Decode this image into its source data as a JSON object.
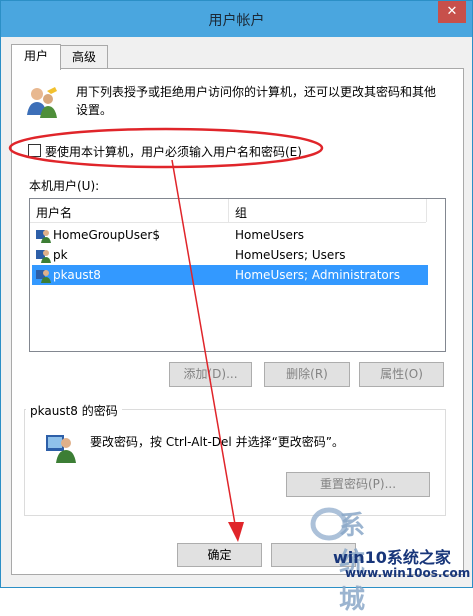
{
  "window": {
    "title": "用户帐户",
    "close_glyph": "✕"
  },
  "tabs": [
    {
      "label": "用户"
    },
    {
      "label": "高级"
    }
  ],
  "description": "用下列表授予或拒绝用户访问你的计算机，还可以更改其密码和其他设置。",
  "require_login_checkbox": {
    "label": "要使用本计算机，用户必须输入用户名和密码(E)",
    "checked": false
  },
  "users_list": {
    "label": "本机用户(U):",
    "columns": [
      "用户名",
      "组"
    ],
    "rows": [
      {
        "name": "HomeGroupUser$",
        "group": "HomeUsers",
        "selected": false
      },
      {
        "name": "pk",
        "group": "HomeUsers; Users",
        "selected": false
      },
      {
        "name": "pkaust8",
        "group": "HomeUsers; Administrators",
        "selected": true
      }
    ]
  },
  "list_buttons": {
    "add": "添加(D)...",
    "remove": "删除(R)",
    "properties": "属性(O)"
  },
  "password_group": {
    "title": "pkaust8 的密码",
    "text": "要改密码，按 Ctrl-Alt-Del 并选择“更改密码”。",
    "reset_button": "重置密码(P)..."
  },
  "dialog_buttons": {
    "ok": "确定"
  },
  "watermark": {
    "logo_text": "系统城",
    "line1": "win10系统之家",
    "line2": "www.win10os.com"
  },
  "colors": {
    "titlebar": "#4aa6df",
    "selection": "#3399ff",
    "annotation_red": "#e0252a",
    "watermark_navy": "#18367a"
  }
}
